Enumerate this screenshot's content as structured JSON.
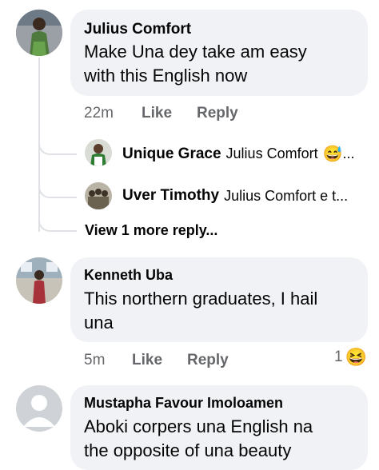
{
  "comments": [
    {
      "author": "Julius Comfort",
      "text_line1": "Make Una dey take am easy",
      "text_line2": "with this English now",
      "time": "22m",
      "like": "Like",
      "reply": "Reply",
      "replies": [
        {
          "author": "Unique Grace",
          "text": "Julius Comfort",
          "emoji": "😅",
          "ellipsis": "..."
        },
        {
          "author": "Uver Timothy",
          "text": "Julius Comfort e t..."
        }
      ],
      "view_more": "View 1 more reply..."
    },
    {
      "author": "Kenneth Uba",
      "text_line1": "This northern graduates, I hail",
      "text_line2": "una",
      "time": "5m",
      "like": "Like",
      "reply": "Reply",
      "reaction_count": "1",
      "reaction_emoji": "😆"
    },
    {
      "author": "Mustapha Favour Imoloamen",
      "text_line1": "Aboki corpers una English na",
      "text_line2": "the opposite of una beauty"
    }
  ],
  "colors": {
    "bubble": "#f0f2f5",
    "meta": "#65676b",
    "thread": "#dfe1e5"
  }
}
